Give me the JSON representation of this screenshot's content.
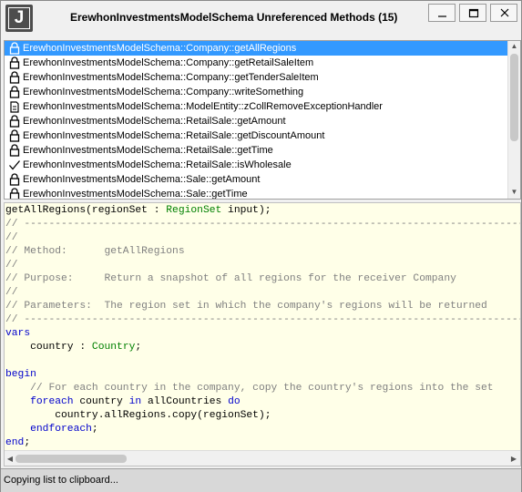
{
  "window": {
    "title": "ErewhonInvestmentsModelSchema Unreferenced Methods (15)",
    "icon_letter": "J"
  },
  "methods": [
    {
      "label": "ErewhonInvestmentsModelSchema::Company::getAllRegions",
      "icon": "lock-icon",
      "selected": true
    },
    {
      "label": "ErewhonInvestmentsModelSchema::Company::getRetailSaleItem",
      "icon": "lock-icon",
      "selected": false
    },
    {
      "label": "ErewhonInvestmentsModelSchema::Company::getTenderSaleItem",
      "icon": "lock-icon",
      "selected": false
    },
    {
      "label": "ErewhonInvestmentsModelSchema::Company::writeSomething",
      "icon": "lock-icon",
      "selected": false
    },
    {
      "label": "ErewhonInvestmentsModelSchema::ModelEntity::zCollRemoveExceptionHandler",
      "icon": "page-icon",
      "selected": false
    },
    {
      "label": "ErewhonInvestmentsModelSchema::RetailSale::getAmount",
      "icon": "lock-icon",
      "selected": false
    },
    {
      "label": "ErewhonInvestmentsModelSchema::RetailSale::getDiscountAmount",
      "icon": "lock-icon",
      "selected": false
    },
    {
      "label": "ErewhonInvestmentsModelSchema::RetailSale::getTime",
      "icon": "lock-icon",
      "selected": false
    },
    {
      "label": "ErewhonInvestmentsModelSchema::RetailSale::isWholesale",
      "icon": "check-icon",
      "selected": false
    },
    {
      "label": "ErewhonInvestmentsModelSchema::Sale::getAmount",
      "icon": "lock-icon",
      "selected": false
    },
    {
      "label": "ErewhonInvestmentsModelSchema::Sale::getTime",
      "icon": "lock-icon",
      "selected": false
    }
  ],
  "code": {
    "signature": {
      "name": "getAllRegions(regionSet : ",
      "type": "RegionSet",
      "rest": " input);"
    },
    "rule": "// ------------------------------------------------------------------------------------------------",
    "comment_blank": "//",
    "method_line": "// Method:      getAllRegions",
    "purpose_line": "// Purpose:     Return a snapshot of all regions for the receiver Company",
    "params_line": "// Parameters:  The region set in which the company's regions will be returned",
    "vars_kw": "vars",
    "var_name": "    country : ",
    "var_type": "Country",
    "var_end": ";",
    "begin_kw": "begin",
    "loop_comment": "    // For each country in the company, copy the country's regions into the set",
    "foreach_kw": "foreach",
    "foreach_var": " country ",
    "in_kw": "in",
    "foreach_coll": " allCountries ",
    "do_kw": "do",
    "body_line": "        country.allRegions.copy(regionSet);",
    "endforeach_kw": "endforeach",
    "endforeach_semi": ";",
    "end_kw": "end",
    "end_semi": ";"
  },
  "status": {
    "text": "Copying list to clipboard..."
  },
  "colors": {
    "selection": "#3399ff",
    "editor_background": "#ffffe8",
    "keyword": "#0000cc",
    "type": "#008000",
    "comment": "#808080"
  }
}
